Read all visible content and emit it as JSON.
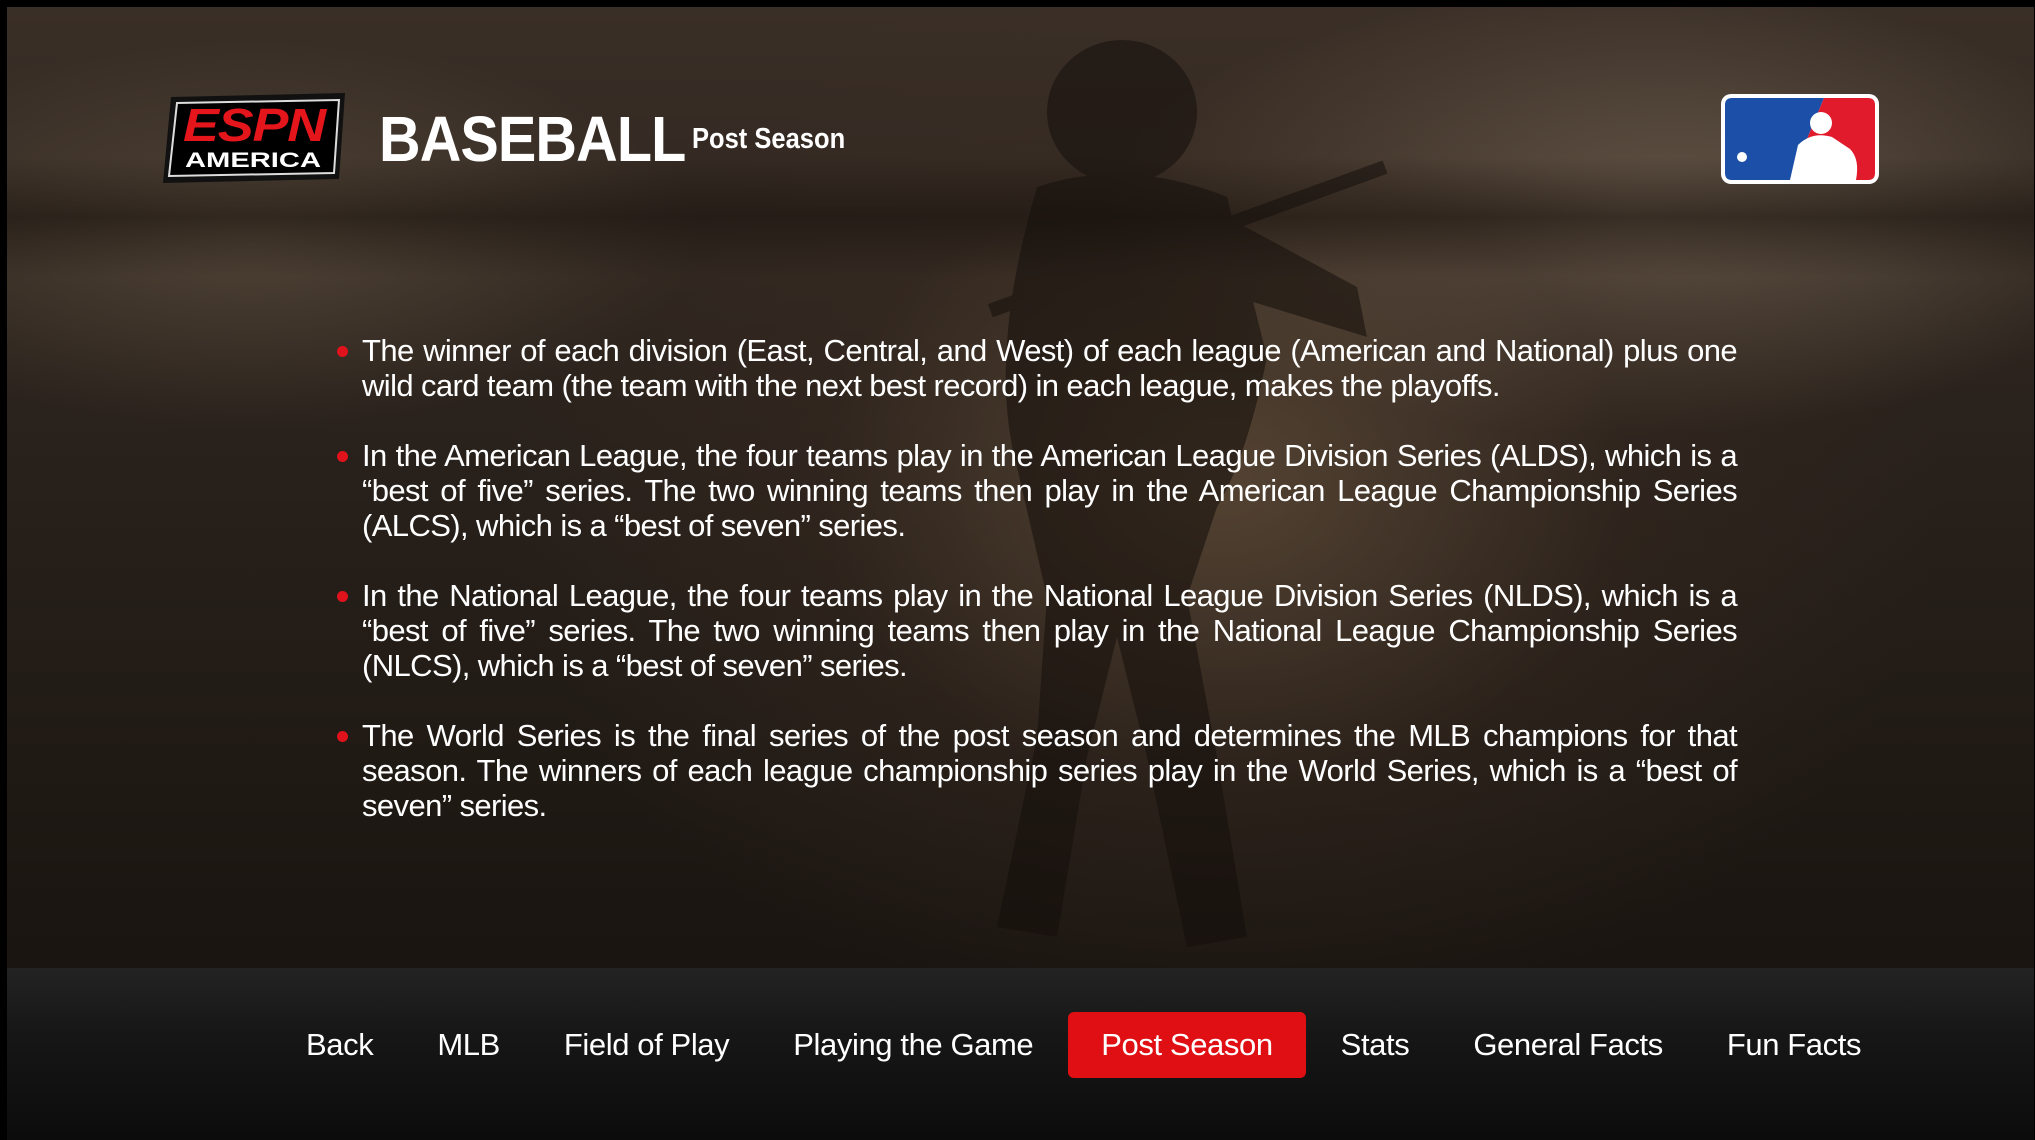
{
  "header": {
    "brand_logo_line1": "ESPN",
    "brand_logo_line2": "AMERICA",
    "title": "BASEBALL",
    "subtitle": "Post Season",
    "league_logo": "mlb-logo"
  },
  "content": {
    "bullets": [
      "The winner of each division (East, Central, and West) of each league (American and National) plus one wild card team (the team with the next best record) in each league, makes the playoffs.",
      "In the American League, the four teams play in the American League Division Series (ALDS), which is a “best of five” series.  The two winning teams then play in the American League Championship Series (ALCS), which is a “best of seven” series.",
      "In the National League, the four teams play in the National League Division Series (NLDS), which is a “best of five” series.  The two winning teams then play in the National League Championship Series (NLCS), which is a “best of seven” series.",
      "The World Series is the final series of the post season and determines the MLB champions for that season. The winners of each league championship series play in the World Series, which is a “best of seven” series."
    ]
  },
  "nav": {
    "items": [
      {
        "label": "Back"
      },
      {
        "label": "MLB"
      },
      {
        "label": "Field of Play"
      },
      {
        "label": "Playing the Game"
      },
      {
        "label": "Post Season"
      },
      {
        "label": "Stats"
      },
      {
        "label": "General Facts"
      },
      {
        "label": "Fun Facts"
      }
    ],
    "active_index": 4
  },
  "colors": {
    "accent": "#e00f14",
    "bullet": "#e0121c",
    "text": "#ffffff",
    "mlb_blue": "#1c4fa8",
    "mlb_red": "#e11b2b"
  }
}
